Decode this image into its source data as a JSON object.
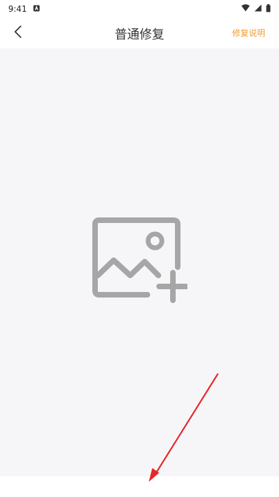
{
  "status_bar": {
    "time": "9:41",
    "notification_icon": "a-notification-icon",
    "wifi_icon": "wifi-icon",
    "signal_icon": "signal-icon",
    "battery_icon": "battery-icon"
  },
  "header": {
    "back_icon": "chevron-left-icon",
    "title": "普通修复",
    "help_label": "修复说明"
  },
  "canvas": {
    "add_image_icon": "image-add-icon"
  },
  "annotation": {
    "arrow_color": "#e8262a"
  },
  "colors": {
    "accent": "#f39c35",
    "canvas_bg": "#f6f6f8",
    "icon_gray": "#a6a6a6"
  }
}
